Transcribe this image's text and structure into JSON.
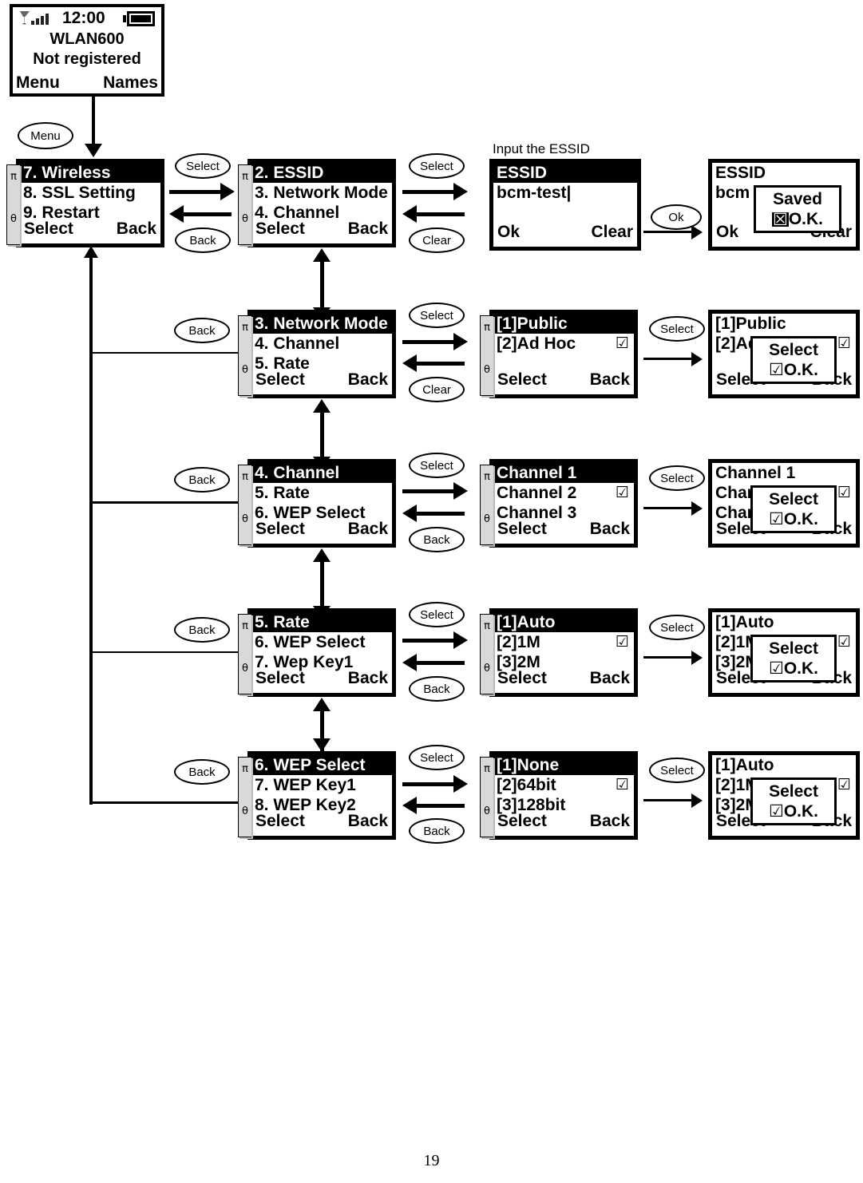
{
  "page_number": "19",
  "idle_screen": {
    "status_time": "12:00",
    "signal_icon": "signal-bars-icon",
    "battery_icon": "battery-full-icon",
    "line1": "WLAN600",
    "line2": "Not registered",
    "softkey_left": "Menu",
    "softkey_right": "Names"
  },
  "caption_essid": "Input the ESSID",
  "scroll": {
    "up": "π",
    "down": "θ"
  },
  "keys": {
    "menu": "Menu",
    "select": "Select",
    "back": "Back",
    "clear": "Clear",
    "ok": "Ok"
  },
  "rows": [
    {
      "menu": {
        "title": "7. Wireless",
        "items": [
          "8. SSL Setting",
          "9. Restart"
        ],
        "softkey_left": "Select",
        "softkey_right": "Back"
      },
      "sub": {
        "title": "2. ESSID",
        "items": [
          "3. Network Mode",
          "4. Channel"
        ],
        "softkey_left": "Select",
        "softkey_right": "Back"
      },
      "detail": {
        "title": "ESSID",
        "value": "bcm-test|",
        "softkey_left": "Ok",
        "softkey_right": "Clear"
      },
      "result": {
        "title": "ESSID",
        "value": "bcm",
        "softkey_left": "Ok",
        "softkey_right": "Clear",
        "popup": {
          "line1": "Saved",
          "line2": "O.K.",
          "mark": "inverted"
        }
      }
    },
    {
      "menu": {
        "title": "3. Network Mode",
        "items": [
          "4. Channel",
          "5. Rate"
        ],
        "softkey_left": "Select",
        "softkey_right": "Back"
      },
      "options": {
        "title": "[1]Public",
        "items": [
          {
            "label": "[2]Ad Hoc",
            "checked": true
          },
          {
            "label": "",
            "checked": false
          }
        ],
        "softkey_left": "Select",
        "softkey_right": "Back"
      },
      "result": {
        "title": "[1]Public",
        "items": [
          {
            "label": "[2]Ad Hoc",
            "checked": true
          },
          {
            "label": "",
            "checked": false
          }
        ],
        "softkey_left": "Select",
        "softkey_right": "Back",
        "popup": {
          "line1": "Select",
          "line2": "O.K.",
          "mark": "check"
        }
      }
    },
    {
      "menu": {
        "title": "4. Channel",
        "items": [
          "5. Rate",
          "6. WEP Select"
        ],
        "softkey_left": "Select",
        "softkey_right": "Back"
      },
      "options": {
        "title": "Channel 1",
        "items": [
          {
            "label": "Channel 2",
            "checked": true
          },
          {
            "label": "Channel 3",
            "checked": false
          }
        ],
        "softkey_left": "Select",
        "softkey_right": "Back"
      },
      "result": {
        "title": "Channel 1",
        "items": [
          {
            "label": "Channel 2",
            "checked": true
          },
          {
            "label": "Channel 3",
            "checked": false
          }
        ],
        "softkey_left": "Select",
        "softkey_right": "Back",
        "popup": {
          "line1": "Select",
          "line2": "O.K.",
          "mark": "check"
        }
      }
    },
    {
      "menu": {
        "title": "5. Rate",
        "items": [
          "6. WEP Select",
          "7. Wep Key1"
        ],
        "softkey_left": "Select",
        "softkey_right": "Back"
      },
      "options": {
        "title": "[1]Auto",
        "items": [
          {
            "label": "[2]1M",
            "checked": true
          },
          {
            "label": "[3]2M",
            "checked": false
          }
        ],
        "softkey_left": "Select",
        "softkey_right": "Back"
      },
      "result": {
        "title": "[1]Auto",
        "items": [
          {
            "label": "[2]1M",
            "checked": true
          },
          {
            "label": "[3]2M",
            "checked": false
          }
        ],
        "softkey_left": "Select",
        "softkey_right": "Back",
        "popup": {
          "line1": "Select",
          "line2": "O.K.",
          "mark": "check"
        }
      }
    },
    {
      "menu": {
        "title": "6. WEP Select",
        "items": [
          "7. WEP Key1",
          "8. WEP Key2"
        ],
        "softkey_left": "Select",
        "softkey_right": "Back"
      },
      "options": {
        "title": "[1]None",
        "items": [
          {
            "label": "[2]64bit",
            "checked": true
          },
          {
            "label": "[3]128bit",
            "checked": false
          }
        ],
        "softkey_left": "Select",
        "softkey_right": "Back"
      },
      "result": {
        "title": "[1]Auto",
        "items": [
          {
            "label": "[2]1M",
            "checked": true
          },
          {
            "label": "[3]2M",
            "checked": false
          }
        ],
        "softkey_left": "Select",
        "softkey_right": "Back",
        "popup": {
          "line1": "Select",
          "line2": "O.K.",
          "mark": "check"
        }
      }
    }
  ],
  "checkbox_glyph": "☑"
}
